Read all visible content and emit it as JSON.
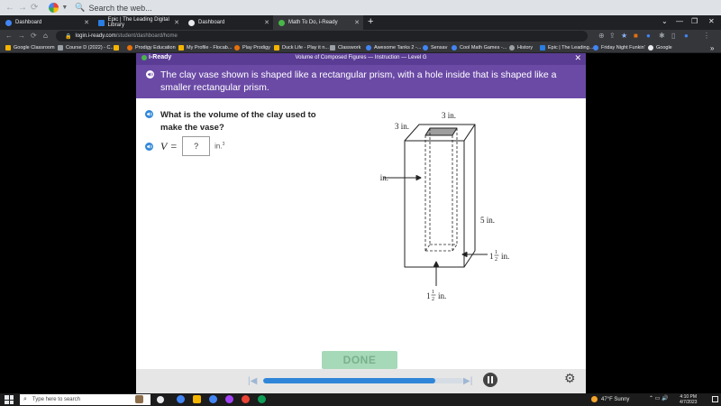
{
  "browser": {
    "search_placeholder": "Search the web...",
    "tabs": [
      {
        "label": "Dashboard",
        "icon": "dashboard-icon",
        "color": "#4285f4"
      },
      {
        "label": "Epic | The Leading Digital Library",
        "icon": "epic-icon",
        "color": "#2a7de1"
      },
      {
        "label": "Dashboard",
        "icon": "dashboard-icon",
        "color": "#e8eaed"
      },
      {
        "label": "Math To Do, i-Ready",
        "icon": "iready-icon",
        "color": "#49b648"
      }
    ],
    "url_host": "login.i-ready.com",
    "url_path": "/student/dashboard/home",
    "bookmarks": [
      {
        "label": "Google Classroom",
        "color": "#f4b400"
      },
      {
        "label": "Course D (2022) - C...",
        "color": "#9aa0a6"
      },
      {
        "label": "",
        "color": "#f4b400"
      },
      {
        "label": "Prodigy Education",
        "color": "#e8710a"
      },
      {
        "label": "My Profile - Flocab...",
        "color": "#f4b400"
      },
      {
        "label": "Play Prodigy",
        "color": "#e8710a"
      },
      {
        "label": "Duck Life - Play it n...",
        "color": "#f4b400"
      },
      {
        "label": "Classwork",
        "color": "#9aa0a6"
      },
      {
        "label": "Awesome Tanks 2 -...",
        "color": "#4285f4"
      },
      {
        "label": "Sensav",
        "color": "#4285f4"
      },
      {
        "label": "Cool Math Games -...",
        "color": "#4285f4"
      },
      {
        "label": "History",
        "color": "#9aa0a6"
      },
      {
        "label": "Epic | The Leading...",
        "color": "#2a7de1"
      },
      {
        "label": "Friday Night Funkin'",
        "color": "#4285f4"
      },
      {
        "label": "Google",
        "color": "#e8eaed"
      }
    ],
    "more_bookmarks": "»"
  },
  "lesson": {
    "logo": "i-Ready",
    "title": "Volume of Composed Figures — Instruction — Level G",
    "banner": "The clay vase shown is shaped like a rectangular prism, with a hole inside that is shaped like a smaller rectangular prism.",
    "question": "What is the volume of the clay used to make the vase?",
    "variable": "V",
    "equals": "=",
    "answer_value": "?",
    "unit": "in.",
    "unit_exp": "3",
    "done_label": "DONE",
    "progress_fraction": 0.86
  },
  "figure": {
    "labels": {
      "top_width": "3 in.",
      "top_depth": "3 in.",
      "height": "5 in.",
      "inner_height": "4 in.",
      "inner_side_whole": "1",
      "inner_side_num": "1",
      "inner_side_den": "2",
      "inner_front_whole": "1",
      "inner_front_num": "1",
      "inner_front_den": "2",
      "unit": "in."
    }
  },
  "taskbar": {
    "search_placeholder": "Type here to search",
    "weather": "47°F  Sunny",
    "time": "4:10 PM",
    "date": "4/7/2023"
  }
}
